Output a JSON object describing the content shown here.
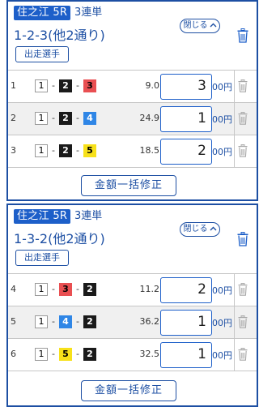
{
  "cards": [
    {
      "venue": "住之江 5R",
      "bet_type": "3連単",
      "combo_title": "1-2-3(他2通り)",
      "close_label": "閉じる",
      "runners_label": "出走選手",
      "bulk_label": "金額一括修正",
      "rows": [
        {
          "index": "1",
          "nums": [
            "1",
            "2",
            "3"
          ],
          "odds": "9.0",
          "amount": "3",
          "unit": "00円"
        },
        {
          "index": "2",
          "nums": [
            "1",
            "2",
            "4"
          ],
          "odds": "24.9",
          "amount": "1",
          "unit": "00円"
        },
        {
          "index": "3",
          "nums": [
            "1",
            "2",
            "5"
          ],
          "odds": "18.5",
          "amount": "2",
          "unit": "00円"
        }
      ]
    },
    {
      "venue": "住之江 5R",
      "bet_type": "3連単",
      "combo_title": "1-3-2(他2通り)",
      "close_label": "閉じる",
      "runners_label": "出走選手",
      "bulk_label": "金額一括修正",
      "rows": [
        {
          "index": "4",
          "nums": [
            "1",
            "3",
            "2"
          ],
          "odds": "11.2",
          "amount": "2",
          "unit": "00円"
        },
        {
          "index": "5",
          "nums": [
            "1",
            "4",
            "2"
          ],
          "odds": "36.2",
          "amount": "1",
          "unit": "00円"
        },
        {
          "index": "6",
          "nums": [
            "1",
            "5",
            "2"
          ],
          "odds": "32.5",
          "amount": "1",
          "unit": "00円"
        }
      ]
    }
  ],
  "boat_colors": {
    "1": "#ffffff",
    "2": "#1a1a1a",
    "3": "#e94f52",
    "4": "#2f86e6",
    "5": "#f7e11a"
  },
  "icons": {
    "trash": "trash-icon",
    "chevron": "chevron-up-icon"
  }
}
